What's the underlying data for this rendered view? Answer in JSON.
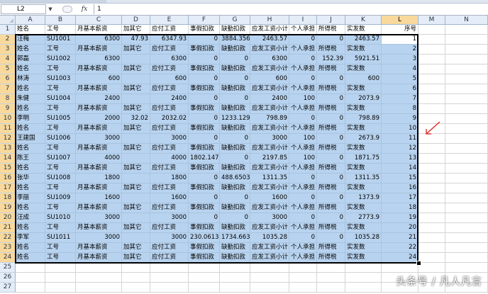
{
  "name_box": "L2",
  "fx_label": "fx",
  "formula_value": "1",
  "columns": [
    "A",
    "B",
    "C",
    "D",
    "E",
    "F",
    "G",
    "H",
    "I",
    "J",
    "K",
    "L",
    "M",
    "N"
  ],
  "rows": [
    [
      "姓名",
      "工号",
      "月基本薪资",
      "加其它",
      "应付工资",
      "事假扣款",
      "缺勤扣款",
      "应发工资小计",
      "个人承担",
      "所得税",
      "实发数",
      "序号"
    ],
    [
      "汪梅",
      "SU1001",
      "6300",
      "47.93",
      "6347.93",
      "0",
      "3884.356",
      "2463.57",
      "0",
      "0",
      "2463.57",
      "1"
    ],
    [
      "姓名",
      "工号",
      "月基本薪资",
      "加其它",
      "应付工资",
      "事假扣款",
      "缺勤扣款",
      "应发工资小计",
      "个人承担",
      "所得税",
      "实发数",
      "2"
    ],
    [
      "郭磊",
      "SU1002",
      "6300",
      "",
      "6300",
      "0",
      "0",
      "6300",
      "0",
      "152.39",
      "5921.51",
      "3"
    ],
    [
      "姓名",
      "工号",
      "月基本薪资",
      "加其它",
      "应付工资",
      "事假扣款",
      "缺勤扣款",
      "应发工资小计",
      "个人承担",
      "所得税",
      "实发数",
      "4"
    ],
    [
      "林涛",
      "SU1003",
      "600",
      "",
      "600",
      "0",
      "0",
      "600",
      "0",
      "0",
      "600",
      "5"
    ],
    [
      "姓名",
      "工号",
      "月基本薪资",
      "加其它",
      "应付工资",
      "事假扣款",
      "缺勤扣款",
      "应发工资小计",
      "个人承担",
      "所得税",
      "实发数",
      "6"
    ],
    [
      "朱健",
      "SU1004",
      "2400",
      "",
      "2400",
      "0",
      "0",
      "2400",
      "100",
      "0",
      "2073.9",
      "7"
    ],
    [
      "姓名",
      "工号",
      "月基本薪资",
      "加其它",
      "应付工资",
      "事假扣款",
      "缺勤扣款",
      "应发工资小计",
      "个人承担",
      "所得税",
      "实发数",
      "8"
    ],
    [
      "李明",
      "SU1005",
      "2000",
      "32.02",
      "2032.02",
      "0",
      "1233.129",
      "798.89",
      "0",
      "0",
      "798.89",
      "9"
    ],
    [
      "姓名",
      "工号",
      "月基本薪资",
      "加其它",
      "应付工资",
      "事假扣款",
      "缺勤扣款",
      "应发工资小计",
      "个人承担",
      "所得税",
      "实发数",
      "10"
    ],
    [
      "王建国",
      "SU1006",
      "3000",
      "",
      "3000",
      "0",
      "0",
      "3000",
      "100",
      "0",
      "2673.9",
      "11"
    ],
    [
      "姓名",
      "工号",
      "月基本薪资",
      "加其它",
      "应付工资",
      "事假扣款",
      "缺勤扣款",
      "应发工资小计",
      "个人承担",
      "所得税",
      "实发数",
      "12"
    ],
    [
      "陈王",
      "SU1007",
      "4000",
      "",
      "4000",
      "1802.147",
      "0",
      "2197.85",
      "100",
      "0",
      "1871.75",
      "13"
    ],
    [
      "姓名",
      "工号",
      "月基本薪资",
      "加其它",
      "应付工资",
      "事假扣款",
      "缺勤扣款",
      "应发工资小计",
      "个人承担",
      "所得税",
      "实发数",
      "14"
    ],
    [
      "张华",
      "SU1008",
      "1800",
      "",
      "1800",
      "0",
      "488.6503",
      "1311.35",
      "0",
      "0",
      "1311.35",
      "15"
    ],
    [
      "姓名",
      "工号",
      "月基本薪资",
      "加其它",
      "应付工资",
      "事假扣款",
      "缺勤扣款",
      "应发工资小计",
      "个人承担",
      "所得税",
      "实发数",
      "16"
    ],
    [
      "李丽",
      "SU1009",
      "1600",
      "",
      "1600",
      "0",
      "0",
      "1600",
      "0",
      "0",
      "1373.9",
      "17"
    ],
    [
      "姓名",
      "工号",
      "月基本薪资",
      "加其它",
      "应付工资",
      "事假扣款",
      "缺勤扣款",
      "应发工资小计",
      "个人承担",
      "所得税",
      "实发数",
      "18"
    ],
    [
      "汪成",
      "SU1010",
      "3000",
      "",
      "3000",
      "0",
      "0",
      "3000",
      "0",
      "0",
      "2773.9",
      "19"
    ],
    [
      "姓名",
      "工号",
      "月基本薪资",
      "加其它",
      "应付工资",
      "事假扣款",
      "缺勤扣款",
      "应发工资小计",
      "个人承担",
      "所得税",
      "实发数",
      "20"
    ],
    [
      "李军",
      "SU1011",
      "3000",
      "",
      "3000",
      "230.0613",
      "1734.663",
      "1035.28",
      "0",
      "0",
      "1035.28",
      "21"
    ],
    [
      "姓名",
      "工号",
      "月基本薪资",
      "加其它",
      "应付工资",
      "事假扣款",
      "缺勤扣款",
      "应发工资小计",
      "个人承担",
      "所得税",
      "实发数",
      "22"
    ],
    [
      "姓名",
      "工号",
      "月基本薪资",
      "加其它",
      "应付工资",
      "事假扣款",
      "缺勤扣款",
      "应发工资小计",
      "个人承担",
      "所得税",
      "实发数",
      "24"
    ]
  ],
  "empty_row_numbers": [
    "25",
    "26",
    "27"
  ],
  "watermark": "头条号 / 凡人凡言",
  "colors": {
    "selection": "#b8d3ef",
    "header_bg": "#e4ecf7",
    "arrow": "#e02020"
  }
}
